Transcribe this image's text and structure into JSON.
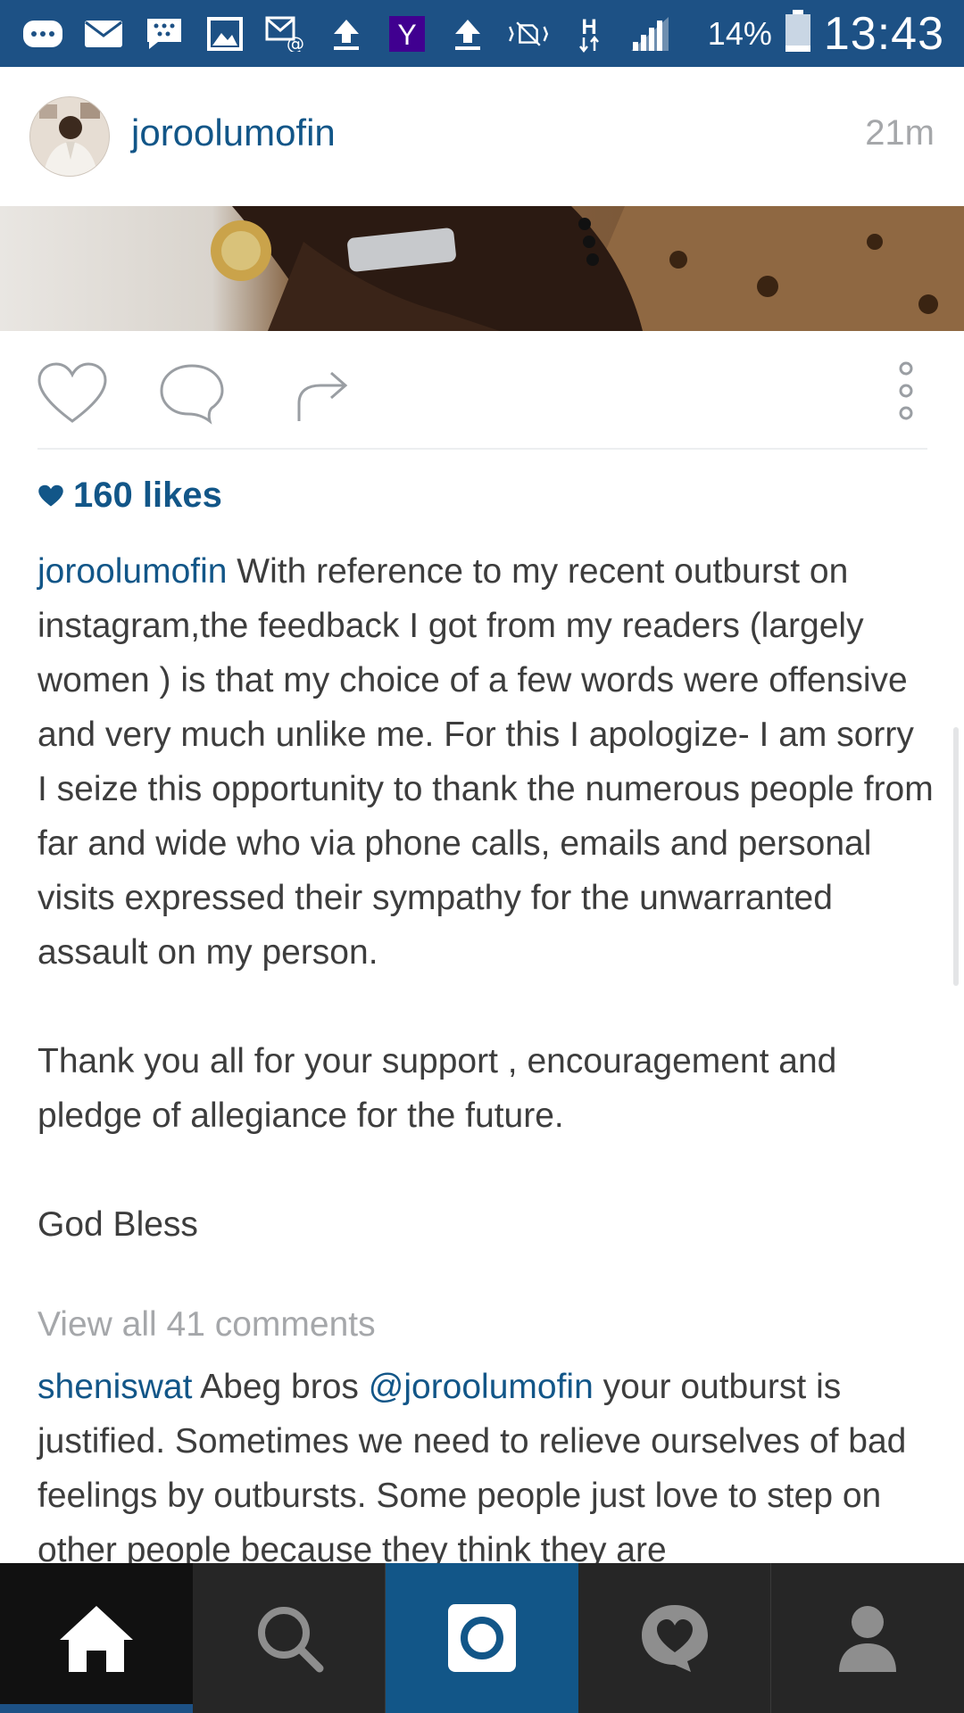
{
  "status_bar": {
    "icons": [
      "bbm-icon",
      "mail-icon",
      "blackberry-icon",
      "gallery-icon",
      "email-at-icon",
      "upload-icon",
      "yahoo-icon",
      "upload-icon",
      "nfc-mute-icon",
      "hspa-icon",
      "signal-icon"
    ],
    "yahoo_letter": "Y",
    "hspa_letter": "H",
    "battery_percent": "14%",
    "time": "13:43"
  },
  "post": {
    "username": "joroolumofin",
    "time_ago": "21m",
    "likes": "160 likes",
    "caption_user": "joroolumofin",
    "caption_text": " With reference to my recent outburst on instagram,the feedback I got from my readers (largely women ) is that my choice of a few words were offensive and very much unlike me. For this I apologize- I am sorry\nI seize this opportunity to thank the numerous people from far and wide who via phone calls, emails and personal visits expressed their sympathy for the unwarranted assault on my person.\n\nThank you all for your support , encouragement and pledge of allegiance for the future.\n\nGod Bless",
    "view_all_comments": "View all 41 comments",
    "comment": {
      "user": "sheniswat",
      "text_before": " Abeg bros ",
      "mention": "@joroolumofin",
      "text_after": " your outburst is justified. Sometimes we need to relieve ourselves of bad feelings by outbursts. Some people just love to step on other people because they think they are"
    }
  },
  "actions": [
    "like-button",
    "comment-button",
    "share-button",
    "more-options-button"
  ],
  "bottom_nav": [
    "home",
    "search",
    "camera",
    "activity",
    "profile"
  ],
  "colors": {
    "status_bar": "#1d5185",
    "link_blue": "#125688",
    "text": "#3d3d3d",
    "muted": "#a5a7aa",
    "nav_bg": "#262626"
  }
}
